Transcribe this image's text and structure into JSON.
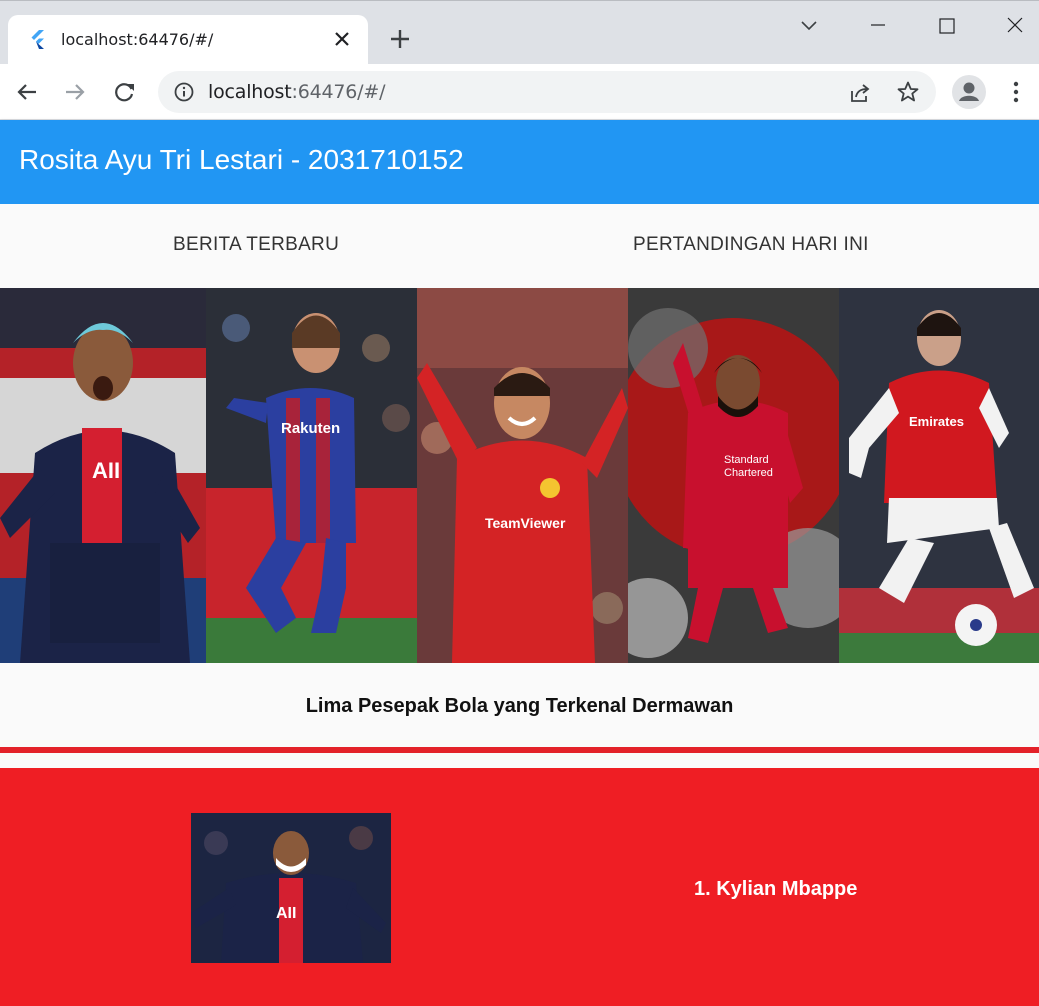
{
  "browser": {
    "tab_title": "localhost:64476/#/",
    "url_host": "localhost",
    "url_path": ":64476/#/"
  },
  "app": {
    "title": "Rosita Ayu Tri Lestari - 2031710152",
    "tabs": [
      "BERITA TERBARU",
      "PERTANDINGAN HARI INI"
    ],
    "heading": "Lima Pesepak Bola yang Terkenal Dermawan",
    "players": [
      {
        "name": "1. Kylian Mbappe",
        "kit": "psg"
      },
      {
        "kit": "barcelona"
      },
      {
        "kit": "manutd"
      },
      {
        "kit": "liverpool"
      },
      {
        "kit": "arsenal"
      }
    ],
    "colors": {
      "appbar": "#2196f3",
      "card": "#ef1e24",
      "divider": "#e32129"
    }
  }
}
